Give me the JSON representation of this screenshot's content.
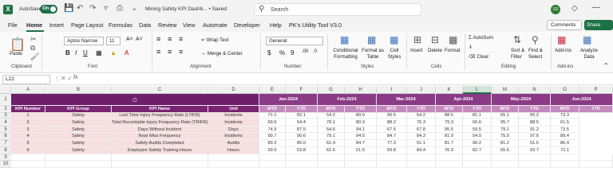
{
  "titlebar": {
    "logo": "X",
    "autosave_label": "AutoSave",
    "toggle_label": "On",
    "title": "Mining Safety KPI Dashb... • Saved",
    "search_placeholder": "Search",
    "avatar_initials": "SS"
  },
  "menu": {
    "items": [
      "File",
      "Home",
      "Insert",
      "Page Layout",
      "Formulas",
      "Data",
      "Review",
      "View",
      "Automate",
      "Developer",
      "Help",
      "PK's Utility Tool V3.0"
    ],
    "active": "Home",
    "comments": "Comments",
    "share": "Share"
  },
  "ribbon": {
    "clipboard": {
      "paste": "Paste",
      "label": "Clipboard"
    },
    "font": {
      "name": "Aptos Narrow",
      "size": "11",
      "label": "Font"
    },
    "alignment": {
      "wrap": "Wrap Text",
      "merge": "Merge & Center",
      "label": "Alignment"
    },
    "number": {
      "format": "General",
      "label": "Number"
    },
    "styles": {
      "cond": "Conditional Formatting",
      "table": "Format as Table",
      "cell": "Cell Styles",
      "label": "Styles"
    },
    "cells": {
      "insert": "Insert",
      "delete": "Delete",
      "format": "Format",
      "label": "Cells"
    },
    "editing": {
      "autosum": "AutoSum",
      "clear": "Clear",
      "sort": "Sort & Filter",
      "find": "Find & Select",
      "label": "Editing"
    },
    "addins": {
      "addins": "Add-ins",
      "analyze": "Analyze Data",
      "label": "Add-ins"
    }
  },
  "formula": {
    "namebox": "L22",
    "fx": "fx"
  },
  "columns": [
    "A",
    "B",
    "C",
    "D",
    "E",
    "F",
    "G",
    "H",
    "I",
    "J",
    "K",
    "L",
    "M",
    "N",
    "O",
    "P"
  ],
  "selected_column": "L",
  "rows": [
    "1",
    "2",
    "3",
    "4",
    "5",
    "6",
    "7",
    "8",
    "9",
    "10"
  ],
  "sheet": {
    "headers": [
      "KPI Number",
      "KPI Group",
      "KPI Name",
      "Unit"
    ],
    "months": [
      "Jan-2024",
      "Feb-2024",
      "Mar-2024",
      "Apr-2024",
      "May-2024",
      "Jun-2024"
    ],
    "mtd": "MTD",
    "ytd": "YTD",
    "data": [
      [
        "1",
        "Safety",
        "Lost Time Injury Frequency Rate (LTIFR)",
        "Incidents",
        "71.1",
        "82.1",
        "54.2",
        "80.0",
        "90.5",
        "54.2",
        "88.5",
        "81.1",
        "65.1",
        "65.2",
        "73.3"
      ],
      [
        "2",
        "Safety",
        "Total Recordable Injury Frequency Rate (TRIFR)",
        "Incidents",
        "69.6",
        "54.4",
        "78.1",
        "80.3",
        "88.2",
        "76.3",
        "79.3",
        "60.6",
        "95.7",
        "88.5",
        "61.5"
      ],
      [
        "3",
        "Safety",
        "Days Without Incident",
        "Days",
        "74.5",
        "87.5",
        "54.6",
        "94.1",
        "67.6",
        "67.8",
        "95.5",
        "59.5",
        "79.1",
        "91.2",
        "73.5"
      ],
      [
        "4",
        "Safety",
        "Near Miss Frequency",
        "Incidents",
        "99.7",
        "90.6",
        "79.1",
        "94.5",
        "84.7",
        "84.3",
        "81.9",
        "54.0",
        "75.0",
        "97.6",
        "89.4"
      ],
      [
        "5",
        "Safety",
        "Safety Audits Completed",
        "Audits",
        "89.2",
        "86.0",
        "61.4",
        "84.7",
        "77.3",
        "51.1",
        "81.7",
        "90.2",
        "81.2",
        "51.5",
        "86.4"
      ],
      [
        "6",
        "Safety",
        "Employee Safety Training Hours",
        "Hours",
        "59.5",
        "53.8",
        "62.6",
        "51.5",
        "59.8",
        "84.4",
        "76.9",
        "82.7",
        "65.6",
        "93.7",
        "72.1"
      ]
    ]
  }
}
